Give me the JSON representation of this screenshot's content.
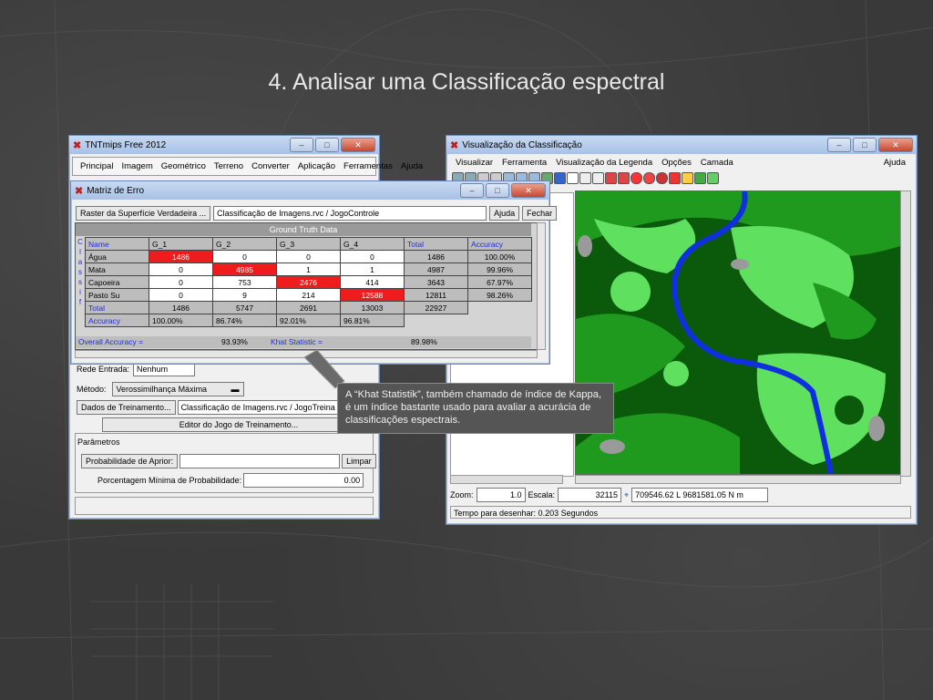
{
  "slide": {
    "title": "4. Analisar uma Classificação espectral"
  },
  "tnt_window": {
    "title": "TNTmips Free 2012",
    "menu": [
      "Principal",
      "Imagem",
      "Geométrico",
      "Terreno",
      "Converter",
      "Aplicação",
      "Ferramentas",
      "Ajuda"
    ],
    "method_label": "Método:",
    "method_value": "Verossimilhança Máxima",
    "training_button": "Dados de Treinamento...",
    "training_value": "Classificação de Imagens.rvc / JogoTreina",
    "editor_button": "Editor do Jogo de Treinamento...",
    "params_label": "Parâmetros",
    "prob_label": "Probabilidade de Aprior:",
    "clear_button": "Limpar",
    "min_prob_label": "Porcentagem Mínima de Probabilidade:",
    "min_prob_value": "0.00",
    "rede_label": "Rede Entrada:",
    "rede_value": "Nenhum"
  },
  "matrix_window": {
    "title": "Matriz de Erro",
    "raster_button": "Raster da Superfície Verdadeira ...",
    "raster_value": "Classificação de Imagens.rvc / JogoControle",
    "help_button": "Ajuda",
    "close_button": "Fechar",
    "ground_truth": "Ground Truth Data",
    "side_letters": [
      "C",
      "l",
      "a",
      "s",
      "s",
      "i",
      "f"
    ],
    "columns": [
      "Name",
      "G_1",
      "G_2",
      "G_3",
      "G_4",
      "Total",
      "Accuracy"
    ],
    "rows": [
      {
        "name": "Água",
        "cells": [
          "1486",
          "0",
          "0",
          "0"
        ],
        "total": "1486",
        "accuracy": "100.00%"
      },
      {
        "name": "Mata",
        "cells": [
          "0",
          "4985",
          "1",
          "1"
        ],
        "total": "4987",
        "accuracy": "99.96%"
      },
      {
        "name": "Capoeira",
        "cells": [
          "0",
          "753",
          "2476",
          "414"
        ],
        "total": "3643",
        "accuracy": "67.97%"
      },
      {
        "name": "Pasto Su",
        "cells": [
          "0",
          "9",
          "214",
          "12588"
        ],
        "total": "12811",
        "accuracy": "98.26%"
      }
    ],
    "total_row": {
      "label": "Total",
      "values": [
        "1486",
        "5747",
        "2691",
        "13003",
        "22927"
      ]
    },
    "accuracy_row": {
      "label": "Accuracy",
      "values": [
        "100.00%",
        "86.74%",
        "92.01%",
        "96.81%"
      ]
    },
    "overall_label": "Overall Accuracy =",
    "overall_value": "93.93%",
    "kappa_label": "Khat Statistic =",
    "kappa_value": "89.98%"
  },
  "viz_window": {
    "title": "Visualização da Classificação",
    "menu": [
      "Visualizar",
      "Ferramenta",
      "Visualização da Legenda",
      "Opções",
      "Camada"
    ],
    "help": "Ajuda",
    "zoom_label": "Zoom:",
    "zoom_value": "1.0",
    "scale_label": "Escala:",
    "scale_value": "32115",
    "coords": "709546.62 L  9681581.05 N m",
    "status": "Tempo para desenhar: 0.203 Segundos"
  },
  "callout": {
    "text": "A “Khat Statistik”, também chamado de índice de Kappa, é um índice bastante usado para avaliar a acurácia de classificações espectrais."
  },
  "colors": {
    "highlight_red": "#ee1c1c",
    "river_blue": "#1030e0",
    "veg_dark": "#0b5a0b",
    "veg_mid": "#1f9a1f",
    "veg_light": "#5fe05f",
    "bare_gray": "#9a9a9a"
  }
}
